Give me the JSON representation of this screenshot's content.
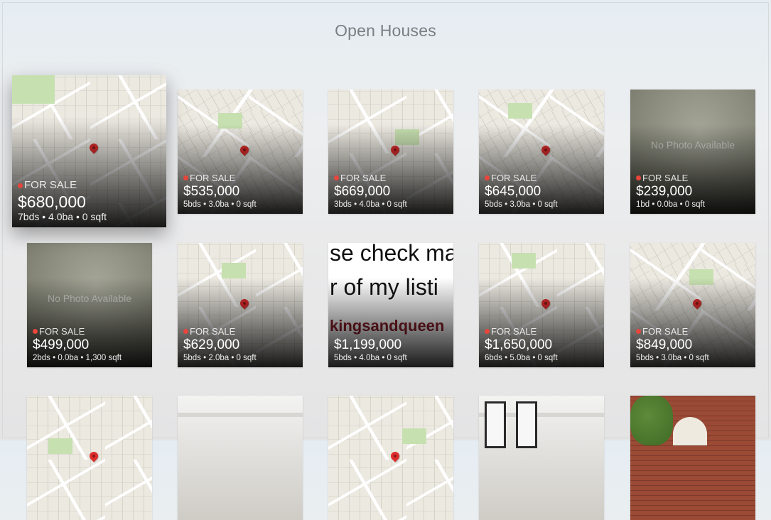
{
  "title": "Open Houses",
  "listings": [
    {
      "status": "FOR SALE",
      "price": "$680,000",
      "specs": "7bds • 4.0ba • 0 sqft",
      "image": "map",
      "focused": true
    },
    {
      "status": "FOR SALE",
      "price": "$535,000",
      "specs": "5bds • 3.0ba • 0 sqft",
      "image": "map"
    },
    {
      "status": "FOR SALE",
      "price": "$669,000",
      "specs": "3bds • 4.0ba • 0 sqft",
      "image": "map"
    },
    {
      "status": "FOR SALE",
      "price": "$645,000",
      "specs": "5bds • 3.0ba • 0 sqft",
      "image": "map"
    },
    {
      "status": "FOR SALE",
      "price": "$239,000",
      "specs": "1bd • 0.0ba • 0 sqft",
      "image": "nophoto",
      "placeholder": "No Photo Available"
    },
    {
      "status": "FOR SALE",
      "price": "$499,000",
      "specs": "2bds • 0.0ba • 1,300 sqft",
      "image": "nophoto",
      "placeholder": "No Photo Available"
    },
    {
      "status": "FOR SALE",
      "price": "$629,000",
      "specs": "5bds • 2.0ba • 0 sqft",
      "image": "map"
    },
    {
      "status": "",
      "price": "$1,199,000",
      "specs": "5bds • 4.0ba • 0 sqft",
      "image": "text",
      "image_text": [
        "se check ma",
        "r of my listi",
        "kingsandqueen"
      ]
    },
    {
      "status": "FOR SALE",
      "price": "$1,650,000",
      "specs": "6bds • 5.0ba • 0 sqft",
      "image": "map"
    },
    {
      "status": "FOR SALE",
      "price": "$849,000",
      "specs": "5bds • 3.0ba • 0 sqft",
      "image": "map"
    },
    {
      "image": "map"
    },
    {
      "image": "room"
    },
    {
      "image": "map"
    },
    {
      "image": "room"
    },
    {
      "image": "brick"
    }
  ],
  "colors": {
    "accent": "#e8463c",
    "pin": "#dd2d2d"
  }
}
